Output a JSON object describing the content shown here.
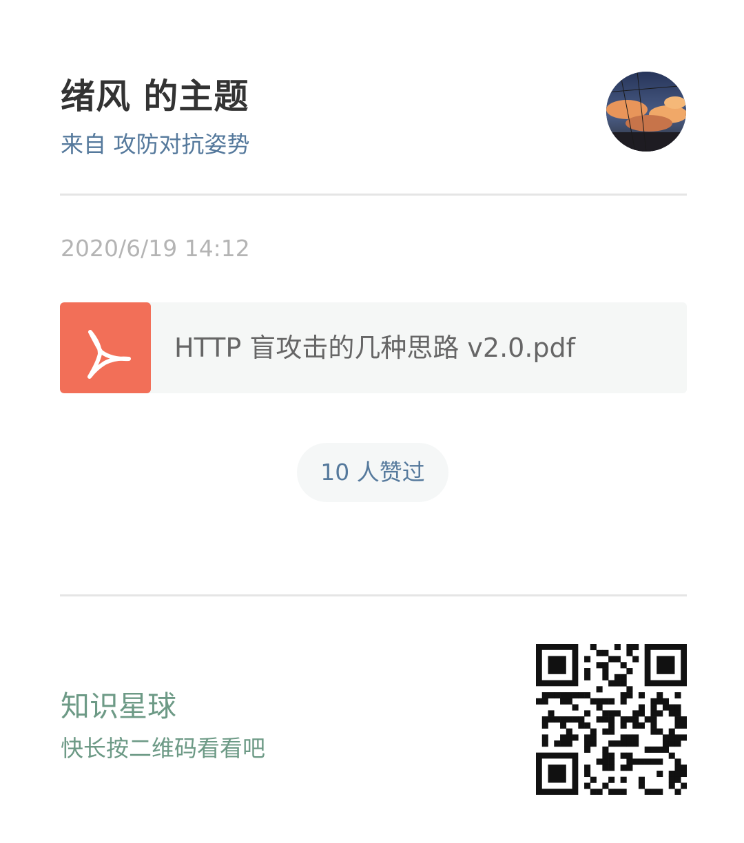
{
  "header": {
    "title": "绪风 的主题",
    "source": "来自 攻防对抗姿势"
  },
  "post": {
    "timestamp": "2020/6/19 14:12",
    "attachment": {
      "icon": "pdf-icon",
      "file_name": "HTTP 盲攻击的几种思路 v2.0.pdf"
    },
    "likes_label": "10 人赞过"
  },
  "footer": {
    "brand": "知识星球",
    "hint": "快长按二维码看看吧"
  },
  "colors": {
    "accent_blue": "#55799c",
    "pdf_orange": "#f26f58",
    "brand_green": "#6d9a86"
  }
}
